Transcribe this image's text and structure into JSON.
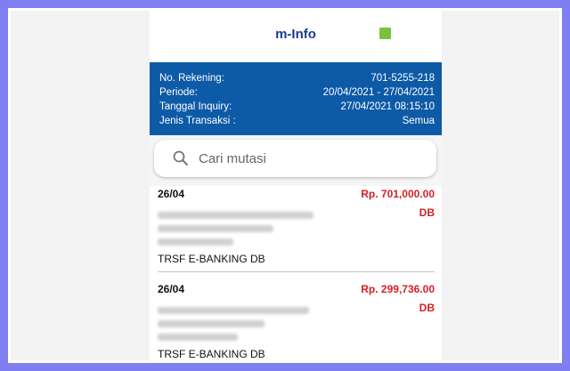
{
  "app": {
    "title": "m-Info"
  },
  "colors": {
    "header_blue": "#0d5aa7",
    "debit_red": "#d32026",
    "status_green": "#7ac142"
  },
  "info": {
    "rows": [
      {
        "label": "No. Rekening:",
        "value": "701-5255-218"
      },
      {
        "label": "Periode:",
        "value": "20/04/2021 - 27/04/2021"
      },
      {
        "label": "Tanggal Inquiry:",
        "value": "27/04/2021 08:15:10"
      },
      {
        "label": "Jenis Transaksi :",
        "value": "Semua"
      }
    ]
  },
  "search": {
    "placeholder": "Cari mutasi",
    "icon": "search-icon"
  },
  "transactions": [
    {
      "date": "26/04",
      "amount": "Rp. 701,000.00",
      "type": "DB",
      "description": "TRSF E-BANKING DB"
    },
    {
      "date": "26/04",
      "amount": "Rp. 299,736.00",
      "type": "DB",
      "description": "TRSF E-BANKING DB"
    }
  ]
}
